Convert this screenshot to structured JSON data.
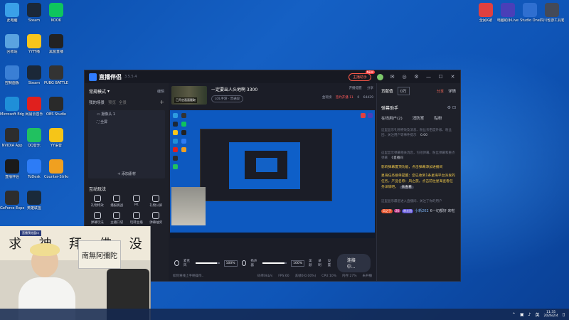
{
  "desktop": {
    "left_icons": [
      {
        "label": "此电脑",
        "icon": "computer-icon",
        "color": "#3aa0e8"
      },
      {
        "label": "Steam",
        "icon": "steam-icon",
        "color": "#1b2838"
      },
      {
        "label": "KOOK",
        "icon": "kook-icon",
        "color": "#0ec45e"
      },
      {
        "label": "回收站",
        "icon": "recycle-bin-icon",
        "color": "#5aa3e0"
      },
      {
        "label": "YY开播",
        "icon": "yy-icon",
        "color": "#f8c51c"
      },
      {
        "label": "黑盒直播",
        "icon": "heihe-icon",
        "color": "#222222"
      },
      {
        "label": "控制面板",
        "icon": "control-panel-icon",
        "color": "#3a7fd5"
      },
      {
        "label": "Steam",
        "icon": "steam-icon",
        "color": "#1b2838"
      },
      {
        "label": "PUBG BATTLEGRO",
        "icon": "pubg-icon",
        "color": "#333333"
      },
      {
        "label": "Microsoft Edge",
        "icon": "edge-icon",
        "color": "#1f8fd8"
      },
      {
        "label": "网易云音乐",
        "icon": "netease-music-icon",
        "color": "#e0201e"
      },
      {
        "label": "OBS Studio",
        "icon": "obs-icon",
        "color": "#2a2a2a"
      },
      {
        "label": "NVIDIA App",
        "icon": "nvidia-icon",
        "color": "#2d2d2d"
      },
      {
        "label": "QQ音乐",
        "icon": "qq-music-icon",
        "color": "#21c160"
      },
      {
        "label": "YY语音",
        "icon": "yy-voice-icon",
        "color": "#f5c518"
      },
      {
        "label": "直播伴侣",
        "icon": "live-companion-icon",
        "color": "#1a1a1a"
      },
      {
        "label": "ToDesk",
        "icon": "todesk-icon",
        "color": "#2d7cf6"
      },
      {
        "label": "Counter-Strike 2",
        "icon": "cs2-icon",
        "color": "#f0a020"
      },
      {
        "label": "GeForce Experience",
        "icon": "geforce-icon",
        "color": "#2d2d2d"
      },
      {
        "label": "英雄联盟",
        "icon": "lol-icon",
        "color": "#1a2a3a"
      }
    ],
    "right_icons": [
      {
        "label": "全民K歌",
        "icon": "kge-icon",
        "color": "#e04040"
      },
      {
        "label": "电脑助手Live",
        "icon": "live-assist-icon",
        "color": "#4a3fb8"
      },
      {
        "label": "Studio One",
        "icon": "studio-one-icon",
        "color": "#2f6fd0"
      },
      {
        "label": "四川省游工具箱",
        "icon": "toolbox-icon",
        "color": "#444a58"
      }
    ]
  },
  "app": {
    "title": "直播伴侣",
    "version": "3.5.5.4",
    "dev_button": "主播助手",
    "dev_badge": "NEW",
    "window_controls": [
      "—",
      "☐",
      "✕"
    ],
    "left": {
      "mode_label": "常规模式",
      "edit": "编辑",
      "scene_label": "我的场景",
      "scene_tab_1": "预览",
      "scene_tab_2": "全景",
      "sources": [
        "摄像头 1",
        "全屏"
      ],
      "add_source": "+ 添加素材",
      "section_interact": "互动玩法",
      "tools_interact": [
        "礼物特效",
        "播报挑战",
        "PK",
        "礼物公屏",
        "弹幕玩法",
        "主播口袋",
        "玩转主播",
        "弹幕抽奖"
      ],
      "section_basic": "基础工具"
    },
    "center": {
      "room_cover_tag": "已开启画面截取",
      "room_title": "一定要出人头地啊 3300",
      "room_category": "LOL手游 · 普通段",
      "meta_top": [
        "开播提醒",
        "分享"
      ],
      "meta_bottom": [
        "金玩榜",
        "签约开播 11",
        "0",
        "64429"
      ],
      "controls": {
        "mic_label": "麦克风",
        "mic_volume": "100%",
        "mic_level": 0.9,
        "speaker_label": "扬声器",
        "speaker_volume": "100%",
        "speaker_level": 0.9,
        "beauty": "美颜",
        "record": "录制",
        "settings": "设置",
        "go_live": "连接中..."
      },
      "status": {
        "hint": "如何将线上手柄操作..",
        "bitrate": "码率0kb/s",
        "fps": "FPS:60",
        "dropped": "丢帧0(0.00%)",
        "cpu": "CPU:10%",
        "memory": "内存:27%",
        "duration": "未开播"
      }
    },
    "right": {
      "rank_label": "贡献值",
      "rank_value": "0万",
      "share_label": "分享",
      "detail": "详情",
      "assistant_title": "弹幕助手",
      "tabs": [
        "在线用户(2)",
        "消防室",
        "贴粉"
      ],
      "notice_1": "这里显示礼物特效及消息、粉丝亲密度升级、粉丝团、关注用户等事件提示",
      "count_badge": "0.00",
      "notice_2": "这里显示弹幕相关消息，包括弹幕、粉丝弹幕和重点弹幕",
      "count_badge_2": "0直播间",
      "tip_1": "影响弹幕置顶功能，点击弹幕添加进播间",
      "tip_2": "星海任务接单提醒：您已收到1条星海平台派发的任务，产品名称：风之旅。点击前往星海查看任务详情吧。",
      "tip_link": "去查看",
      "notice_3": "这里显示最近进入直播间、关注了你的用户",
      "chat_user": "小新202",
      "chat_badge_1": "风之子",
      "chat_badge_2": "26",
      "chat_badge_3": "粉丝团",
      "chat_msg": "6一切都好 来啦"
    }
  },
  "webcam": {
    "calligraphy": [
      "求",
      "神",
      "拜",
      "佛",
      "没"
    ],
    "scroll_text": "南無阿彌陀",
    "overlay": "直播预览窗口"
  },
  "taskbar": {
    "time": "11:35",
    "date": "2026/2/4",
    "lang": "英"
  }
}
